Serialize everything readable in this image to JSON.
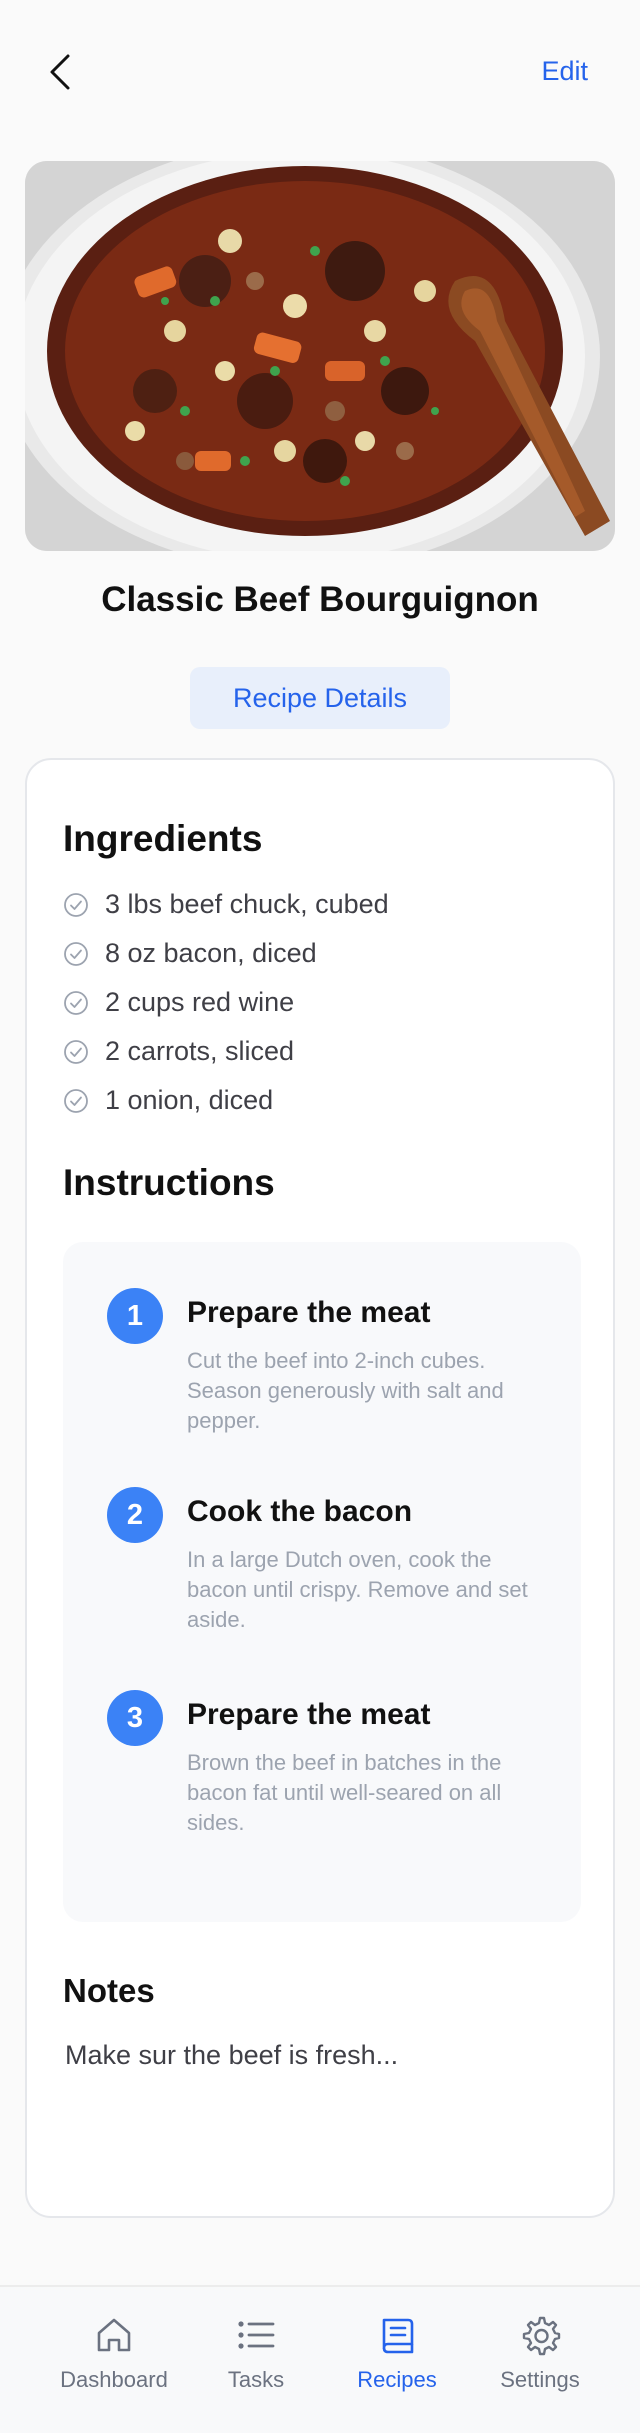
{
  "header": {
    "back_icon": "chevron-left-icon",
    "edit_label": "Edit"
  },
  "recipe": {
    "title": "Classic Beef Bourguignon",
    "details_button": "Recipe Details"
  },
  "ingredients": {
    "heading": "Ingredients",
    "items": [
      "3 lbs beef chuck, cubed",
      "8 oz bacon, diced",
      "2 cups red wine",
      "2 carrots, sliced",
      "1 onion, diced"
    ]
  },
  "instructions": {
    "heading": "Instructions",
    "steps": [
      {
        "number": "1",
        "title": "Prepare the meat",
        "description": "Cut the beef into 2-inch cubes. Season generously with salt and pepper."
      },
      {
        "number": "2",
        "title": "Cook the bacon",
        "description": "In a large Dutch oven, cook the bacon until crispy. Remove and set aside."
      },
      {
        "number": "3",
        "title": "Prepare the meat",
        "description": "Brown the beef in batches in the bacon fat until well-seared on all sides."
      }
    ]
  },
  "notes": {
    "heading": "Notes",
    "text": "Make sur the beef is fresh..."
  },
  "tabbar": {
    "tabs": [
      {
        "label": "Dashboard",
        "icon": "home-icon"
      },
      {
        "label": "Tasks",
        "icon": "list-icon"
      },
      {
        "label": "Recipes",
        "icon": "recipe-book-icon"
      },
      {
        "label": "Settings",
        "icon": "gear-icon"
      }
    ],
    "active_tab": "Recipes"
  },
  "colors": {
    "accent": "#2563eb",
    "step_badge": "#3b82f6",
    "background": "#fafafa"
  }
}
